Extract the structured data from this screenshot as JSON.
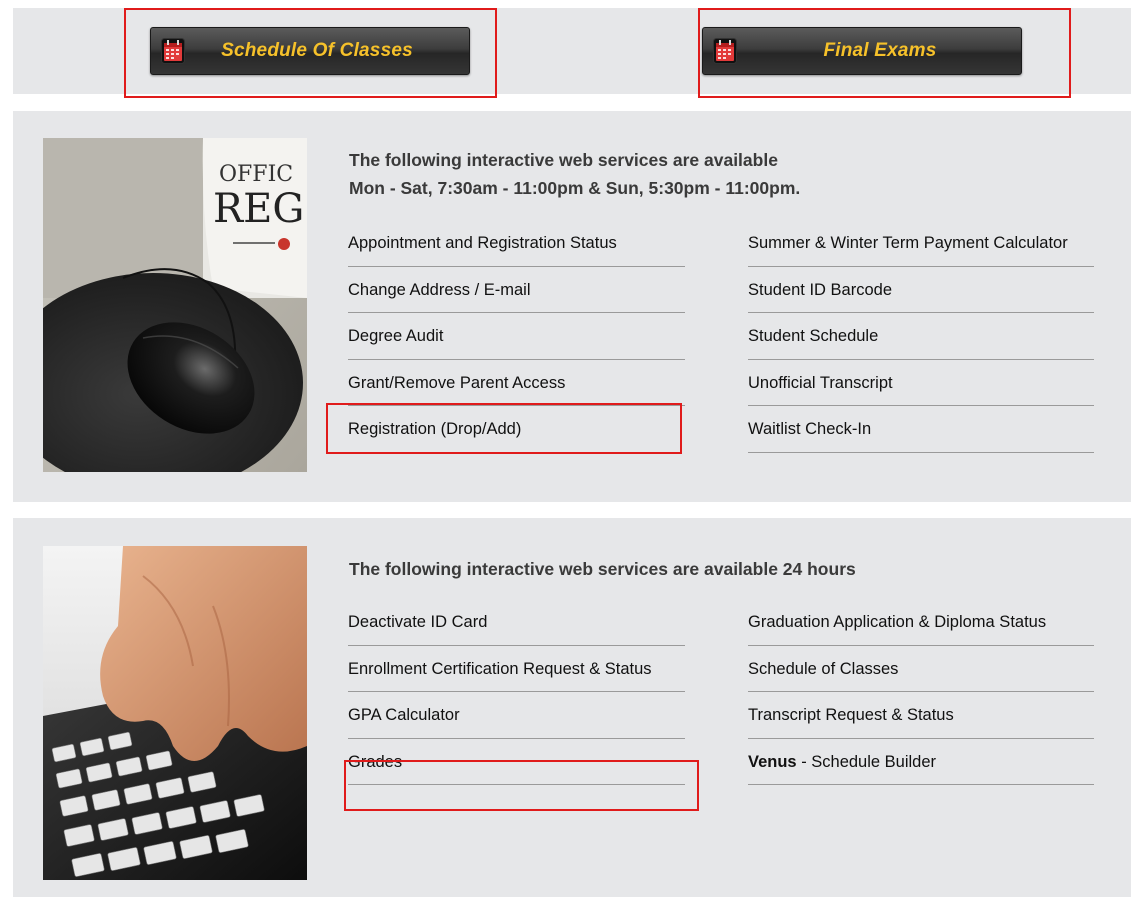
{
  "top_buttons": {
    "schedule_label": "Schedule Of Classes",
    "final_exams_label": "Final Exams"
  },
  "section1": {
    "heading_line1": "The following interactive web services are available",
    "heading_line2": "Mon - Sat, 7:30am - 11:00pm & Sun, 5:30pm - 11:00pm.",
    "photo_text_line1": "OFFIC",
    "photo_text_line2": "REG",
    "left_links": [
      "Appointment and Registration Status",
      "Change Address / E-mail",
      "Degree Audit",
      "Grant/Remove Parent Access",
      "Registration (Drop/Add)"
    ],
    "right_links": [
      "Summer & Winter Term Payment Calculator",
      "Student ID Barcode",
      "Student Schedule",
      "Unofficial Transcript",
      "Waitlist Check-In"
    ]
  },
  "section2": {
    "heading": "The following interactive web services are available 24 hours",
    "left_links": [
      "Deactivate ID Card",
      "Enrollment Certification Request & Status",
      "GPA Calculator",
      "Grades"
    ],
    "right_links": [
      "Graduation Application & Diploma Status",
      "Schedule of Classes",
      "Transcript Request & Status"
    ],
    "venus_bold": "Venus",
    "venus_rest": " - Schedule Builder"
  },
  "colors": {
    "panel_bg": "#e6e7e9",
    "button_text": "#f6c12a",
    "highlight": "#e01b1b",
    "divider": "#9a9a9a"
  },
  "icons": [
    "calendar-icon"
  ]
}
